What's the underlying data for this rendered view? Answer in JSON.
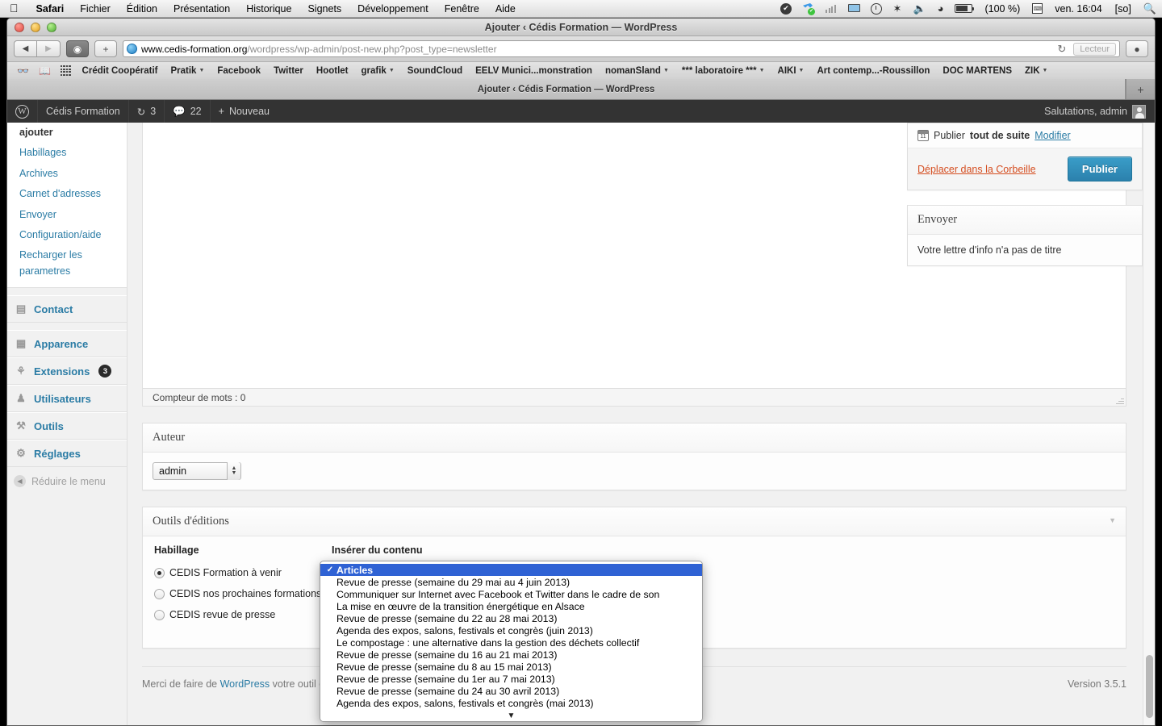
{
  "menubar": {
    "apple_icon": "apple-icon",
    "items": [
      {
        "label": "Safari",
        "bold": true
      },
      {
        "label": "Fichier",
        "bold": false
      },
      {
        "label": "Édition",
        "bold": false
      },
      {
        "label": "Présentation",
        "bold": false
      },
      {
        "label": "Historique",
        "bold": false
      },
      {
        "label": "Signets",
        "bold": false
      },
      {
        "label": "Développement",
        "bold": false
      },
      {
        "label": "Fenêtre",
        "bold": false
      },
      {
        "label": "Aide",
        "bold": false
      }
    ],
    "status": {
      "battery_label": "(100 %)",
      "clock": "ven. 16:04",
      "input_source": "[so]"
    }
  },
  "window": {
    "title": "Ajouter ‹ Cédis Formation — WordPress",
    "tab_title": "Ajouter ‹ Cédis Formation — WordPress",
    "new_tab_label": "+"
  },
  "toolbar": {
    "back_label": "◀",
    "forward_label": "▶",
    "reader_sidebar_label": "0",
    "add_label": "+",
    "url_host": "www.cedis-formation.org",
    "url_path": "/wordpress/wp-admin/post-new.php?post_type=newsletter",
    "reload_label": "↻",
    "reader_label": "Lecteur",
    "downloads_label": "⬇"
  },
  "bookmarks": {
    "items": [
      {
        "label": "Crédit Coopératif",
        "menu": false
      },
      {
        "label": "Pratik",
        "menu": true
      },
      {
        "label": "Facebook",
        "menu": false
      },
      {
        "label": "Twitter",
        "menu": false
      },
      {
        "label": "Hootlet",
        "menu": false
      },
      {
        "label": "grafik",
        "menu": true
      },
      {
        "label": "SoundCloud",
        "menu": false
      },
      {
        "label": "EELV Munici...monstration",
        "menu": false
      },
      {
        "label": "nomanSland",
        "menu": true
      },
      {
        "label": "*** laboratoire ***",
        "menu": true
      },
      {
        "label": "AIKI",
        "menu": true
      },
      {
        "label": "Art contemp...-Roussillon",
        "menu": false
      },
      {
        "label": "DOC MARTENS",
        "menu": false
      },
      {
        "label": "ZIK",
        "menu": true
      }
    ]
  },
  "adminbar": {
    "site_name": "Cédis Formation",
    "updates_count": "3",
    "comments_count": "22",
    "new_label": "Nouveau",
    "greeting": "Salutations, admin"
  },
  "sidebar": {
    "sub_items": [
      {
        "label": "ajouter",
        "current": true
      },
      {
        "label": "Habillages",
        "current": false
      },
      {
        "label": "Archives",
        "current": false
      },
      {
        "label": "Carnet d'adresses",
        "current": false
      },
      {
        "label": "Envoyer",
        "current": false
      },
      {
        "label": "Configuration/aide",
        "current": false
      },
      {
        "label": "Recharger les parametres",
        "current": false
      }
    ],
    "top_items": [
      {
        "label": "Contact",
        "icon": "contact-icon",
        "glyph": "▤",
        "badge": ""
      },
      {
        "label": "Apparence",
        "icon": "appearance-icon",
        "glyph": "▦",
        "badge": ""
      },
      {
        "label": "Extensions",
        "icon": "plugins-icon",
        "glyph": "⚿",
        "badge": "3"
      },
      {
        "label": "Utilisateurs",
        "icon": "users-icon",
        "glyph": "👥",
        "badge": ""
      },
      {
        "label": "Outils",
        "icon": "tools-icon",
        "glyph": "⚒",
        "badge": ""
      },
      {
        "label": "Réglages",
        "icon": "settings-icon",
        "glyph": "⚙",
        "badge": ""
      }
    ],
    "collapse_label": "Réduire le menu"
  },
  "editor": {
    "word_counter": "Compteur de mots : 0"
  },
  "author_box": {
    "title": "Auteur",
    "selected": "admin"
  },
  "tools_box": {
    "title": "Outils d'éditions",
    "left_heading": "Habillage",
    "right_heading": "Insérer du contenu",
    "radios": [
      {
        "label": "CEDIS Formation à venir",
        "checked": true
      },
      {
        "label": "CEDIS nos prochaines formations",
        "checked": false
      },
      {
        "label": "CEDIS revue de presse",
        "checked": false
      }
    ]
  },
  "content_select": {
    "selected": "Articles",
    "options": [
      "Articles",
      "Revue de presse (semaine du 29 mai au 4 juin 2013)",
      "Communiquer sur Internet avec Facebook et Twitter dans le cadre de son",
      "La mise en œuvre de la transition énergétique en Alsace",
      "Revue de presse (semaine du 22 au 28 mai 2013)",
      "Agenda des expos, salons, festivals et congrès (juin 2013)",
      "Le compostage : une alternative dans la gestion des déchets collectif",
      "Revue de presse (semaine du 16 au 21 mai 2013)",
      "Revue de presse (semaine du 8 au 15 mai 2013)",
      "Revue de presse (semaine du 1er au 7 mai 2013)",
      "Revue de presse (semaine du 24 au 30 avril 2013)",
      "Agenda des expos, salons, festivals et congrès (mai 2013)"
    ],
    "scroll_arrow": "▼",
    "check_mark": "✓"
  },
  "publish_box": {
    "schedule_prefix": "Publier",
    "schedule_strong": "tout de suite",
    "edit_label": "Modifier",
    "trash_label": "Déplacer dans la Corbeille",
    "publish_label": "Publier"
  },
  "send_box": {
    "title": "Envoyer",
    "message": "Votre lettre d'info n'a pas de titre"
  },
  "footer": {
    "thanks_prefix": "Merci de faire de ",
    "wordpress_label": "WordPress",
    "thanks_suffix": " votre outil de",
    "version": "Version 3.5.1"
  },
  "colors": {
    "wp_blue": "#2b7ca5",
    "admin_bar": "#333333",
    "trash_red": "#d54e21",
    "select_highlight": "#2f62d4"
  }
}
